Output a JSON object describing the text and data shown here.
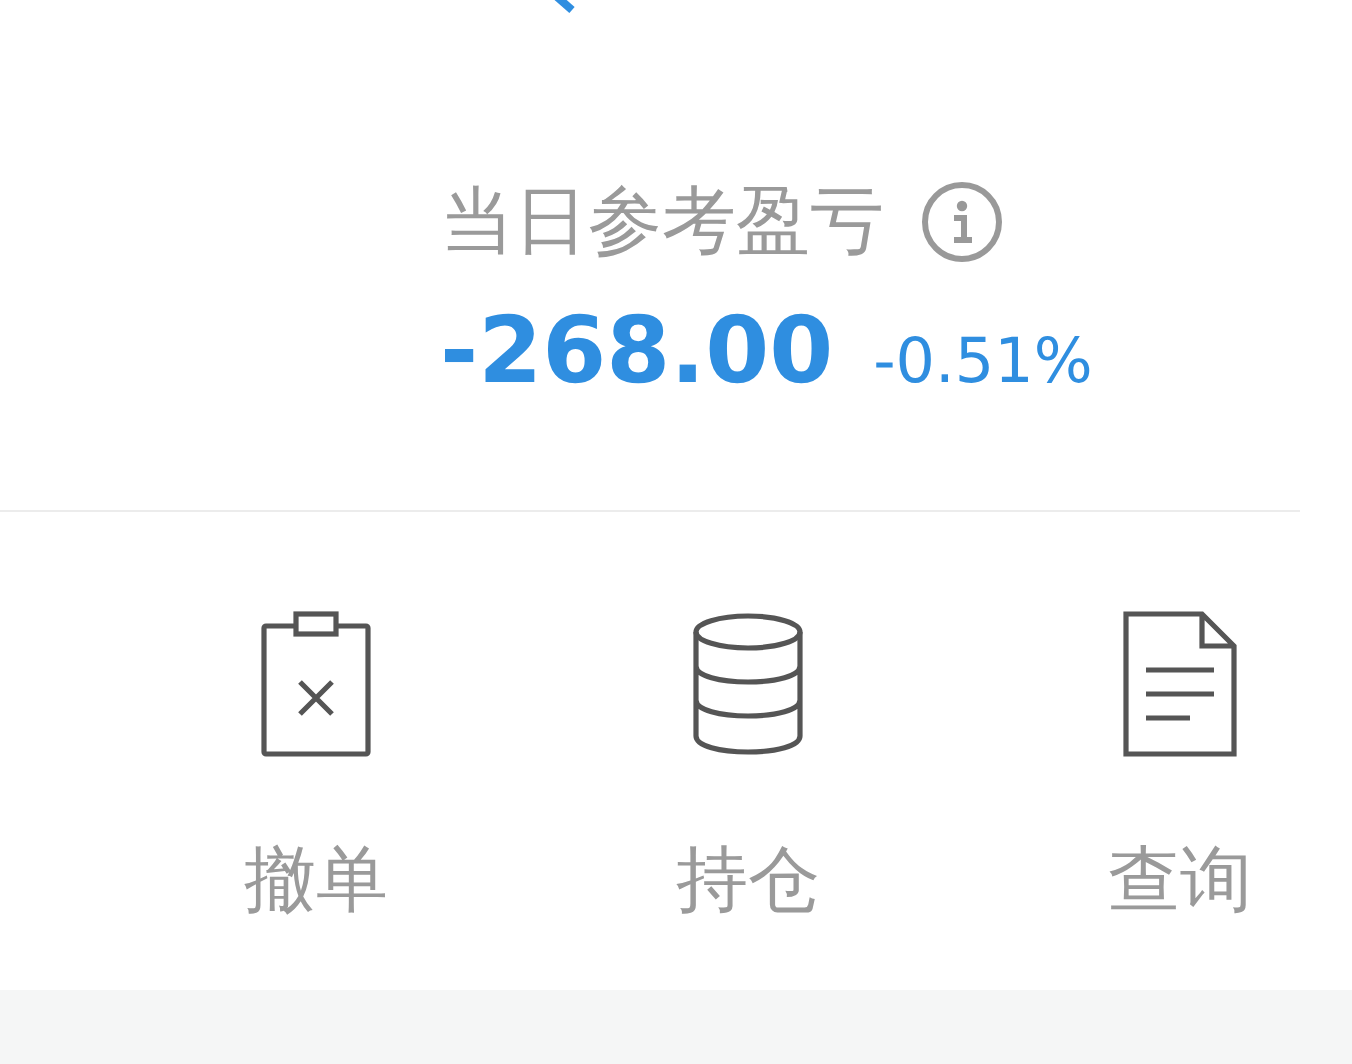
{
  "summary": {
    "label": "当日参考盈亏",
    "amount": "-268.00",
    "percent": "-0.51%"
  },
  "actions": [
    {
      "kind": "cancel",
      "label": "撤单"
    },
    {
      "kind": "positions",
      "label": "持仓"
    },
    {
      "kind": "query",
      "label": "查询"
    }
  ]
}
